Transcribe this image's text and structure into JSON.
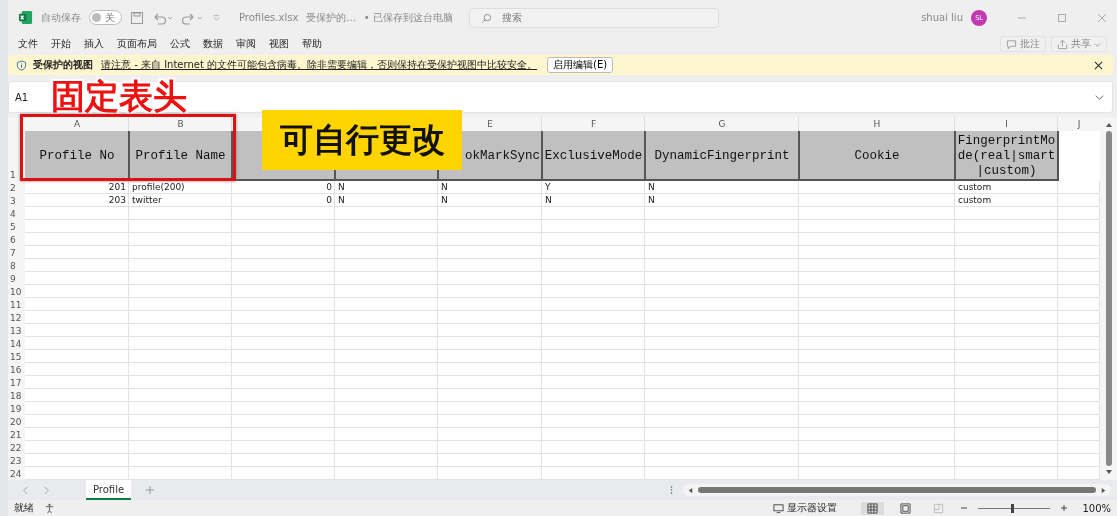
{
  "title_bar": {
    "autosave_label": "自动保存",
    "autosave_toggle": {
      "label": "关",
      "on": false
    },
    "file_name": "Profiles.xlsx",
    "file_mode": "受保护的...",
    "save_status": "• 已保存到这台电脑",
    "search": {
      "placeholder": "搜索"
    },
    "user": {
      "name": "shuai liu",
      "initials": "SL"
    }
  },
  "menu": [
    "文件",
    "开始",
    "插入",
    "页面布局",
    "公式",
    "数据",
    "审阅",
    "视图",
    "帮助"
  ],
  "actions": [
    {
      "kind": "comment",
      "label": "批注"
    },
    {
      "kind": "share",
      "label": "共享"
    }
  ],
  "protected_bar": {
    "title": "受保护的视图",
    "message": "请注意 - 来自 Internet 的文件可能包含病毒。除非需要编辑，否则保持在受保护视图中比较安全。",
    "button": "启用编辑(E)"
  },
  "formula_bar": {
    "name_box": "A1"
  },
  "sheet": {
    "columns": [
      {
        "letter": "A"
      },
      {
        "letter": "B"
      },
      {},
      {},
      {
        "letter": "E"
      },
      {
        "letter": "F"
      },
      {
        "letter": "G"
      },
      {
        "letter": "H"
      },
      {
        "letter": "I"
      },
      {
        "letter": "J"
      }
    ],
    "header_row": {
      "number": "1",
      "cells": [
        {
          "text": "Profile No"
        },
        {
          "text": "Profile Name"
        },
        {},
        {},
        {
          "text": "okMarkSync"
        },
        {
          "text": "ExclusiveMode"
        },
        {
          "text": "DynamicFingerprint"
        },
        {
          "text": "Cookie"
        },
        {
          "text": "FingerprintMode(real|smart|custom)"
        }
      ]
    },
    "rows": [
      {
        "number": "2",
        "cells": [
          {
            "text": "201",
            "numeric": true
          },
          {
            "text": "profile(200)"
          },
          {
            "text": "0",
            "numeric": true
          },
          {
            "text": "N"
          },
          {
            "text": "N"
          },
          {
            "text": "Y"
          },
          {
            "text": "N"
          },
          {},
          {
            "text": "custom"
          },
          {}
        ]
      },
      {
        "number": "3",
        "cells": [
          {
            "text": "203",
            "numeric": true
          },
          {
            "text": "twitter"
          },
          {
            "text": "0",
            "numeric": true
          },
          {
            "text": "N"
          },
          {
            "text": "N"
          },
          {
            "text": "N"
          },
          {
            "text": "N"
          },
          {},
          {
            "text": "custom"
          },
          {}
        ]
      }
    ],
    "empty_rows": [
      "4",
      "5",
      "6",
      "7",
      "8",
      "9",
      "10",
      "11",
      "12",
      "13",
      "14",
      "15",
      "16",
      "17",
      "18",
      "19",
      "20",
      "21",
      "22",
      "23",
      "24"
    ]
  },
  "sheet_tabs": [
    {
      "label": "Profile",
      "selected": true
    }
  ],
  "status_bar": {
    "status": "就绪",
    "display_settings": "显示器设置",
    "zoom": {
      "level": 0.45,
      "reading": "100%"
    }
  },
  "annotations": [
    {
      "kind": "red-caption",
      "text": "固定表头"
    },
    {
      "kind": "yellow-label",
      "text": "可自行更改"
    }
  ]
}
